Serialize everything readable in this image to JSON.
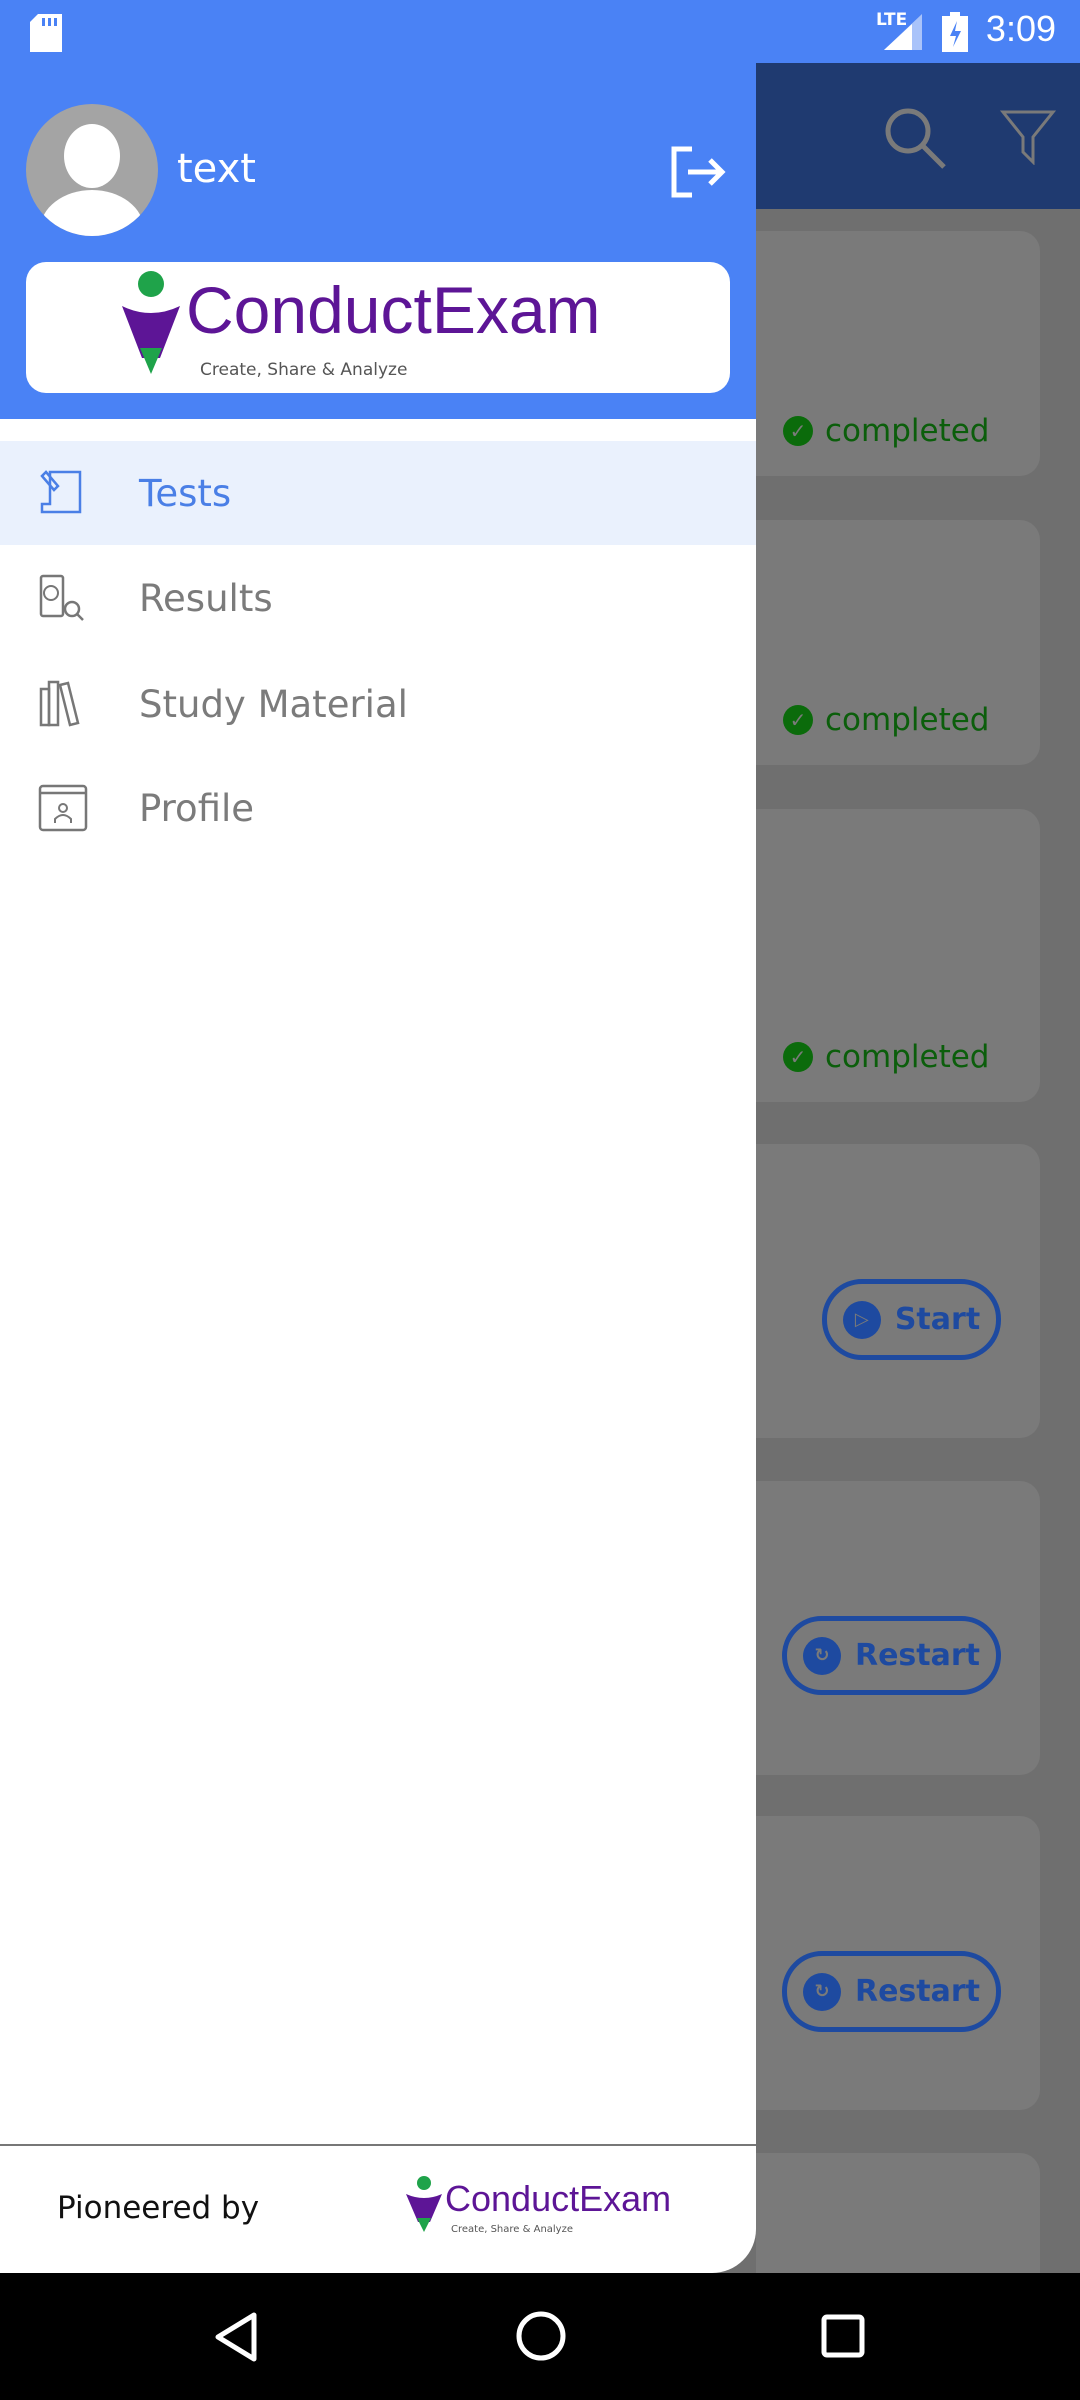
{
  "status_bar": {
    "time": "3:09",
    "network": "LTE",
    "icons": [
      "sd-card-icon",
      "signal-icon",
      "battery-charging-icon"
    ]
  },
  "app_bar": {
    "icons": [
      "search-icon",
      "filter-icon"
    ]
  },
  "drawer": {
    "user_name": "text",
    "logout_icon": "logout-icon",
    "logo": {
      "brand": "ConductExam",
      "tagline": "Create, Share & Analyze"
    },
    "items": [
      {
        "label": "Tests",
        "icon": "test-scroll-icon",
        "selected": true
      },
      {
        "label": "Results",
        "icon": "results-icon"
      },
      {
        "label": "Study Material",
        "icon": "books-icon"
      },
      {
        "label": "Profile",
        "icon": "profile-icon"
      }
    ],
    "footer": {
      "text": "Pioneered by",
      "logo": {
        "brand": "ConductExam",
        "tagline": "Create, Share & Analyze"
      }
    }
  },
  "background_list": {
    "statuses": [
      "completed",
      "completed",
      "completed"
    ],
    "buttons": [
      "Start",
      "Restart",
      "Restart"
    ]
  },
  "colors": {
    "primary": "#4a82f5",
    "selected_bg": "#eaf1fd",
    "completed": "#0b6b0b",
    "button": "#1e4aa0"
  }
}
